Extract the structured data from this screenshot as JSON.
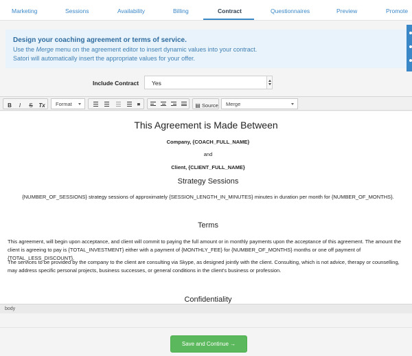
{
  "tabs": [
    {
      "label": "Marketing"
    },
    {
      "label": "Sessions"
    },
    {
      "label": "Availability"
    },
    {
      "label": "Billing"
    },
    {
      "label": "Contract"
    },
    {
      "label": "Questionnaires"
    },
    {
      "label": "Preview"
    },
    {
      "label": "Promote"
    }
  ],
  "active_tab": "Contract",
  "banner": {
    "title": "Design your coaching agreement or terms of service.",
    "line1_prefix": "Use the ",
    "line1_em": "Merge",
    "line1_suffix": " menu on the agreement editor to insert dynamic values into your contract.",
    "line2": "Satori will automatically insert the appropriate values for your offer."
  },
  "include_contract": {
    "label": "Include Contract",
    "value": "Yes"
  },
  "toolbar": {
    "bold": "B",
    "italic": "I",
    "strike": "S",
    "clear_format": "Tx",
    "format_label": "Format",
    "quote": "❞",
    "source_label": "Source",
    "merge_label": "Merge"
  },
  "document": {
    "title": "This Agreement is Made Between",
    "company_line": "Company, {COACH_FULL_NAME}",
    "and": "and",
    "client_line": "Client, {CLIENT_FULL_NAME}",
    "sessions_heading": "Strategy Sessions",
    "sessions_text": "{NUMBER_OF_SESSIONS} strategy sessions of approximately {SESSION_LENGTH_IN_MINUTES} minutes in duration per month for {NUMBER_OF_MONTHS}.",
    "terms_heading": "Terms",
    "terms_p1": "This agreement, will begin upon acceptance, and client will commit to paying the full amount or in monthly payments upon the acceptance of this agreement. The amount the client is agreeing to pay is {TOTAL_INVESTMENT} either with a payment of {MONTHLY_FEE} for {NUMBER_OF_MONTHS} months or one off payment of {TOTAL_LESS_DISCOUNT}.",
    "terms_p2": "The services to be provided by the company to the client are consulting via Skype, as designed jointly with the client. Consulting, which is not advice, therapy or counselling, may address specific personal projects, business successes, or general conditions in the client's business or profession.",
    "confidentiality_heading": "Confidentiality"
  },
  "status_bar": "body",
  "save_button": "Save and Continue →",
  "colors": {
    "accent": "#3a87c8",
    "success": "#5cb85c",
    "banner_bg": "#e9f3fb"
  }
}
